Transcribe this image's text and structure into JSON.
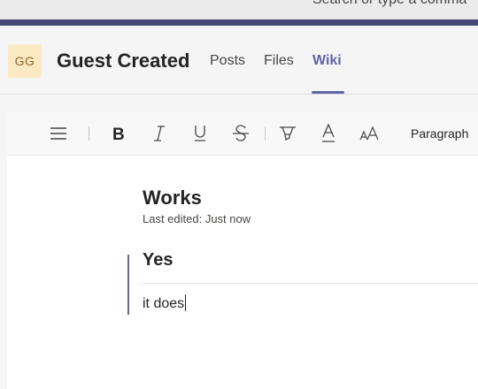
{
  "search": {
    "text": "Search or type a comma"
  },
  "team": {
    "avatar_initials": "GG",
    "name": "Guest Created"
  },
  "tabs": [
    {
      "label": "Posts",
      "active": false
    },
    {
      "label": "Files",
      "active": false
    },
    {
      "label": "Wiki",
      "active": true
    }
  ],
  "toolbar": {
    "icons": [
      "menu-icon",
      "bold-icon",
      "italic-icon",
      "underline-icon",
      "strikethrough-icon",
      "highlight-icon",
      "font-color-icon",
      "font-size-icon"
    ],
    "paragraph_label": "Paragraph"
  },
  "wiki": {
    "page_title": "Works",
    "last_edited": "Last edited: Just now",
    "section": {
      "heading": "Yes",
      "body": "it does"
    }
  },
  "colors": {
    "accent": "#6264a7",
    "app_bar": "#464775",
    "avatar_bg": "#fbe9c3"
  }
}
